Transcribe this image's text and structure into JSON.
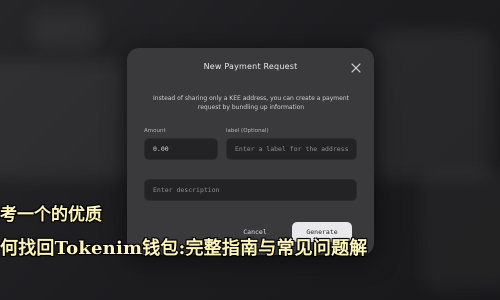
{
  "modal": {
    "title": "New Payment Request",
    "description": "Instead of sharing only a KEE address, you can create a payment request by bundling up information",
    "amount": {
      "label": "Amount",
      "value": "0.00"
    },
    "label_field": {
      "label": "label (Optional)",
      "placeholder": "Enter a label for the address"
    },
    "description_field": {
      "placeholder": "Enter description"
    },
    "buttons": {
      "cancel": "Cancel",
      "generate": "Generate"
    },
    "close_icon": "close-icon"
  },
  "overlay": {
    "line1": "考一个的优质",
    "line2": "何找回Tokenim钱包:完整指南与常见问题解"
  },
  "colors": {
    "background": "#1c1c1e",
    "modal": "#3a3a3d",
    "input": "#232325",
    "generate_button": "#e9e9eb",
    "overlay_text": "#fff6b8"
  }
}
